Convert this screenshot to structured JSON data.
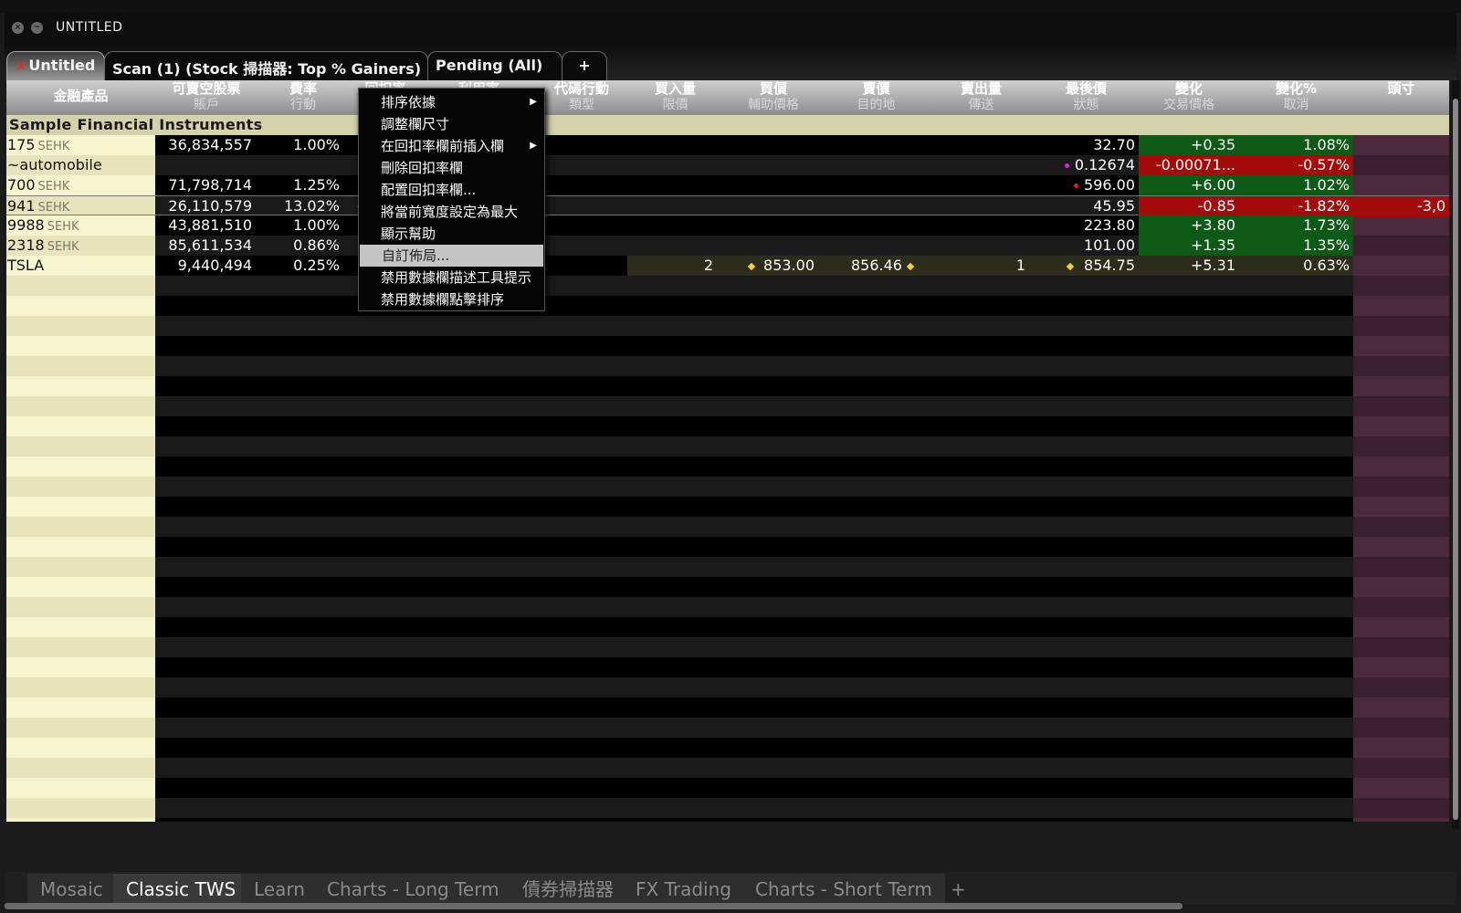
{
  "window": {
    "title": "UNTITLED",
    "close_glyph": "×",
    "min_glyph": "−"
  },
  "tabs": [
    {
      "close": "×",
      "label": "Untitled"
    },
    {
      "label": "Scan (1) (Stock 掃描器: Top % Gainers)"
    },
    {
      "label": "Pending (All)"
    },
    {
      "label": "+"
    }
  ],
  "columns": [
    {
      "h1": "金融產品",
      "h2": ""
    },
    {
      "h1": "可賣空股票",
      "h2": "賬戶"
    },
    {
      "h1": "費率",
      "h2": "行動"
    },
    {
      "h1": "回扣率",
      "h2": ""
    },
    {
      "h1": "利用率",
      "h2": ""
    },
    {
      "h1": "代碼行動",
      "h2": "類型"
    },
    {
      "h1": "買入量",
      "h2": "限價"
    },
    {
      "h1": "買價",
      "h2": "輔助價格"
    },
    {
      "h1": "賣價",
      "h2": "目的地"
    },
    {
      "h1": "賣出量",
      "h2": "傳送"
    },
    {
      "h1": "最後價",
      "h2": "狀態"
    },
    {
      "h1": "變化",
      "h2": "交易價格"
    },
    {
      "h1": "變化%",
      "h2": "取消"
    },
    {
      "h1": "頭寸",
      "h2": ""
    }
  ],
  "group_title": "Sample Financial Instruments",
  "rows": [
    {
      "symbol": "175",
      "exchange": "SEHK",
      "shortable": "36,834,557",
      "fee": "1.00%",
      "rebate": "",
      "bid_size": "",
      "bid": "",
      "ask": "",
      "ask_size": "",
      "last": "32.70",
      "change": "+0.35",
      "change_pct": "1.08%",
      "position": ""
    },
    {
      "symbol": "~automobile",
      "exchange": "",
      "shortable": "",
      "fee": "",
      "rebate": "",
      "bid_size": "",
      "bid": "",
      "ask": "",
      "ask_size": "",
      "last": "0.12674",
      "change": "-0.00071...",
      "change_pct": "-0.57%",
      "position": ""
    },
    {
      "symbol": "700",
      "exchange": "SEHK",
      "shortable": "71,798,714",
      "fee": "1.25%",
      "rebate": "",
      "bid_size": "",
      "bid": "",
      "ask": "",
      "ask_size": "",
      "last": "596.00",
      "change": "+6.00",
      "change_pct": "1.02%",
      "position": ""
    },
    {
      "symbol": "941",
      "exchange": "SEHK",
      "shortable": "26,110,579",
      "fee": "13.02%",
      "rebate": "-",
      "bid_size": "",
      "bid": "",
      "ask": "",
      "ask_size": "",
      "last": "45.95",
      "change": "-0.85",
      "change_pct": "-1.82%",
      "position": "-3,0"
    },
    {
      "symbol": "9988",
      "exchange": "SEHK",
      "shortable": "43,881,510",
      "fee": "1.00%",
      "rebate": "",
      "bid_size": "",
      "bid": "",
      "ask": "",
      "ask_size": "",
      "last": "223.80",
      "change": "+3.80",
      "change_pct": "1.73%",
      "position": ""
    },
    {
      "symbol": "2318",
      "exchange": "SEHK",
      "shortable": "85,611,534",
      "fee": "0.86%",
      "rebate": "",
      "bid_size": "",
      "bid": "",
      "ask": "",
      "ask_size": "",
      "last": "101.00",
      "change": "+1.35",
      "change_pct": "1.35%",
      "position": ""
    },
    {
      "symbol": "TSLA",
      "exchange": "",
      "shortable": "9,440,494",
      "fee": "0.25%",
      "rebate": "",
      "bid_size": "2",
      "bid": "853.00",
      "ask": "856.46",
      "ask_size": "1",
      "last": "854.75",
      "change": "+5.31",
      "change_pct": "0.63%",
      "position": ""
    }
  ],
  "context_menu": {
    "items": [
      {
        "label": "排序依據",
        "submenu": true
      },
      {
        "label": "調整欄尺寸",
        "submenu": false
      },
      {
        "label": "在回扣率欄前插入欄",
        "submenu": true
      },
      {
        "label": "刪除回扣率欄",
        "submenu": false
      },
      {
        "label": "配置回扣率欄...",
        "submenu": false
      },
      {
        "label": "將當前寬度設定為最大",
        "submenu": false
      },
      {
        "label": "顯示幫助",
        "submenu": false
      },
      {
        "label": "自訂佈局...",
        "submenu": false,
        "highlighted": true
      },
      {
        "label": "禁用數據欄描述工具提示",
        "submenu": false
      },
      {
        "label": "禁用數據欄點擊排序",
        "submenu": false
      }
    ],
    "submenu_arrow": "▶"
  },
  "bottom_tabs": [
    {
      "label": "Mosaic"
    },
    {
      "label": "Classic TWS",
      "active": true
    },
    {
      "label": "Learn"
    },
    {
      "label": "Charts - Long Term"
    },
    {
      "label": "債券掃描器"
    },
    {
      "label": "FX Trading"
    },
    {
      "label": "Charts - Short Term"
    },
    {
      "label": "+"
    }
  ],
  "colors": {
    "up": "#0d5a16",
    "down": "#a40c0c",
    "symbol_col": "#f6f3cf",
    "position_col": "#4b2a3c",
    "dot_magenta": "#e020e0",
    "dot_red": "#e02020",
    "diamond": "#f0d040"
  }
}
